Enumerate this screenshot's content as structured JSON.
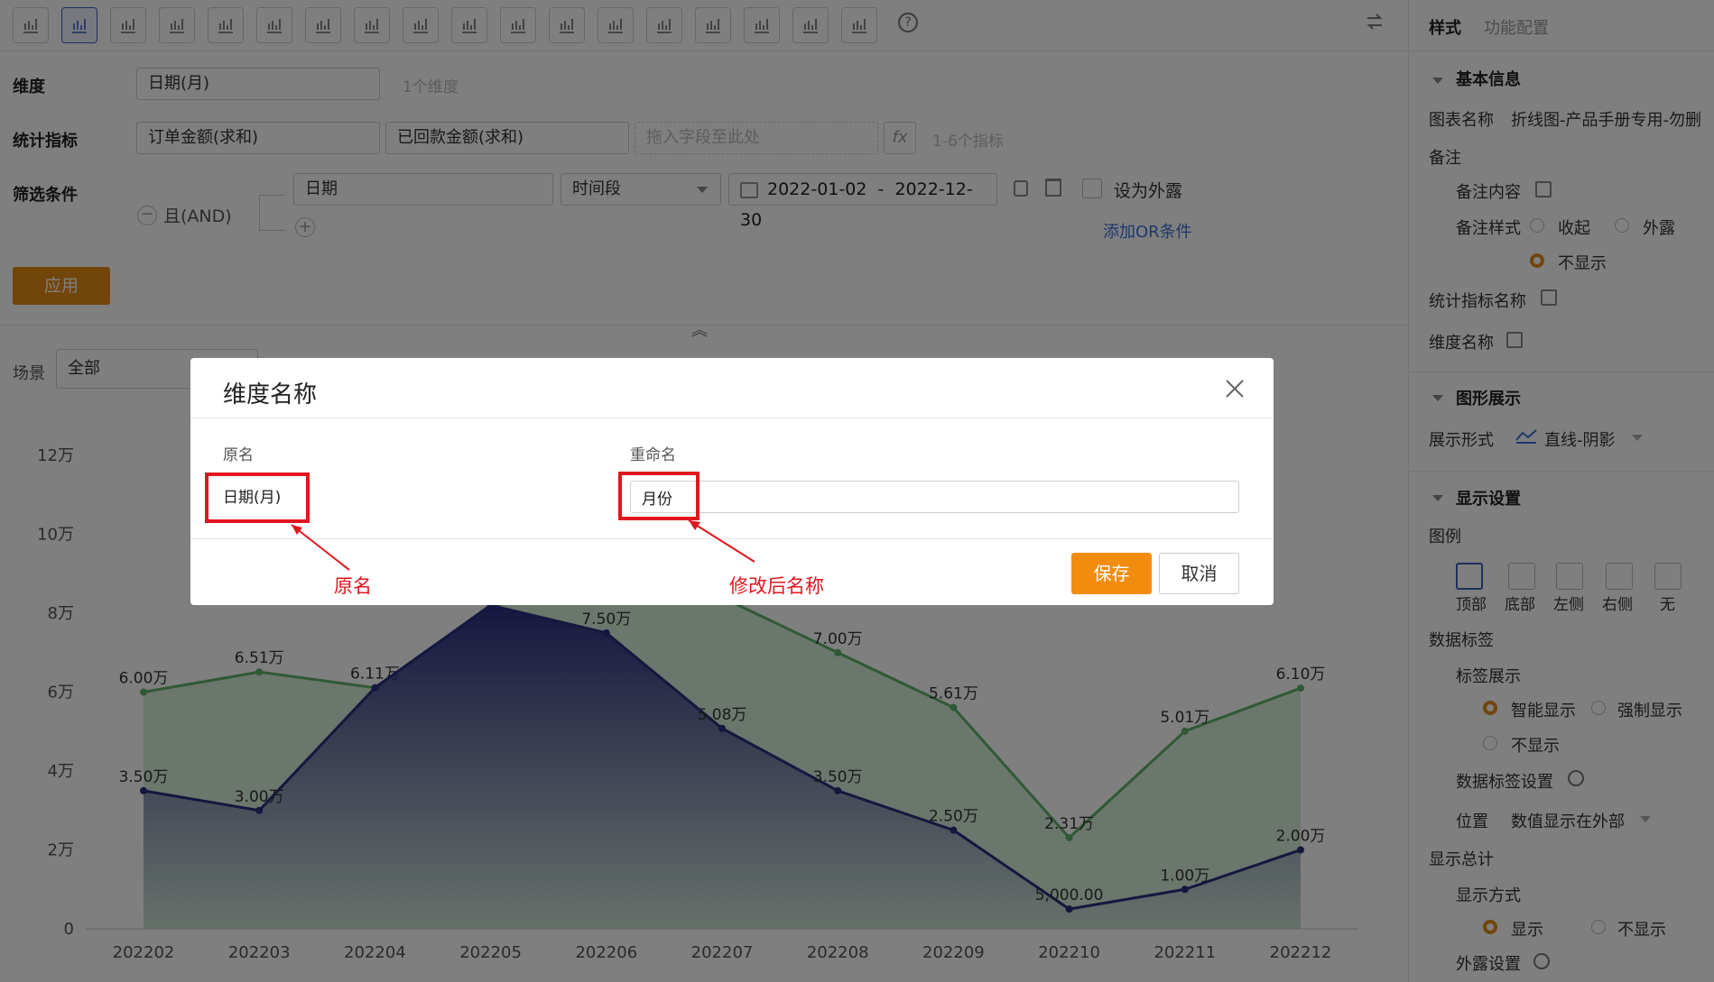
{
  "toolbar": {
    "icons": [
      "bar-chart-icon",
      "line-chart-icon",
      "pie-chart-icon",
      "funnel-icon",
      "funnel-alt-icon",
      "table-icon",
      "combo-chart-icon",
      "text-card-icon",
      "gauge-icon",
      "map-cn-icon",
      "map-cn-alt-icon",
      "world-map-icon",
      "radar-icon",
      "column-icon",
      "area-chart-icon",
      "heatmap-icon",
      "pivot-table-icon",
      "scatter-icon",
      "help-icon"
    ],
    "help_glyph": "?"
  },
  "query": {
    "dimension_label": "维度",
    "dimension_value": "日期(月)",
    "dimension_hint": "1个维度",
    "metric_label": "统计指标",
    "metrics": [
      "订单金额(求和)",
      "已回款金额(求和)"
    ],
    "metric_drop_placeholder": "拖入字段至此处",
    "fx_label": "fx",
    "metric_hint": "1-6个指标",
    "filter_label": "筛选条件",
    "and_label": "且(AND)",
    "filter_field": "日期",
    "filter_op": "时间段",
    "date_start": "2022-01-02",
    "date_sep": "-",
    "date_end": "2022-12-30",
    "expose_label": "设为外露",
    "add_or_label": "添加OR条件",
    "apply_label": "应用"
  },
  "scene": {
    "label": "场景",
    "value": "全部"
  },
  "right_panel": {
    "tabs": [
      "样式",
      "功能配置"
    ],
    "basic_info": "基本信息",
    "chart_name_label": "图表名称",
    "chart_name_value": "折线图-产品手册专用-勿删",
    "note_label": "备注",
    "note_content_label": "备注内容",
    "note_style_label": "备注样式",
    "note_style_options": [
      "收起",
      "外露",
      "不显示"
    ],
    "metric_name_label": "统计指标名称",
    "dimension_name_label": "维度名称",
    "graphic_section": "图形展示",
    "display_form_label": "展示形式",
    "display_form_value": "直线-阴影",
    "display_settings": "显示设置",
    "legend_label": "图例",
    "legend_positions": [
      "顶部",
      "底部",
      "左侧",
      "右侧",
      "无"
    ],
    "data_label_label": "数据标签",
    "label_display_label": "标签展示",
    "label_display_options": [
      "智能显示",
      "强制显示",
      "不显示"
    ],
    "data_label_settings": "数据标签设置",
    "position_label": "位置",
    "position_value": "数值显示在外部",
    "show_total_label": "显示总计",
    "display_mode_label": "显示方式",
    "display_mode_options": [
      "显示",
      "不显示"
    ],
    "expose_settings_label": "外露设置"
  },
  "modal": {
    "title": "维度名称",
    "original_label": "原名",
    "original_value": "日期(月)",
    "rename_label": "重命名",
    "rename_value": "月份",
    "save_label": "保存",
    "cancel_label": "取消",
    "annotation_original": "原名",
    "annotation_rename": "修改后名称",
    "accent_color": "#f28c0f",
    "annotation_color": "#e1161e"
  },
  "chart_data": {
    "type": "area",
    "categories": [
      "202202",
      "202203",
      "202204",
      "202205",
      "202206",
      "202207",
      "202208",
      "202209",
      "202210",
      "202211",
      "202212"
    ],
    "y_ticks": [
      "0",
      "2万",
      "4万",
      "6万",
      "8万",
      "10万",
      "12万"
    ],
    "ylim": [
      0,
      120000
    ],
    "series": [
      {
        "color": "#5fb36b",
        "values": [
          60000,
          65100,
          61100,
          82000,
          85000,
          84000,
          70000,
          56100,
          23100,
          50100,
          61000
        ],
        "labels": [
          "6.00万",
          "6.51万",
          "6.11万",
          "",
          "",
          "",
          "7.00万",
          "5.61万",
          "2.31万",
          "5.01万",
          "6.10万"
        ]
      },
      {
        "color": "#2b2f7e",
        "values": [
          35000,
          30000,
          61100,
          82000,
          75000,
          50800,
          35000,
          25000,
          5000,
          10000,
          20000
        ],
        "labels": [
          "3.50万",
          "3.00万",
          "",
          "",
          "7.50万",
          "5.08万",
          "3.50万",
          "2.50万",
          "5,000.00",
          "1.00万",
          "2.00万"
        ]
      }
    ]
  }
}
